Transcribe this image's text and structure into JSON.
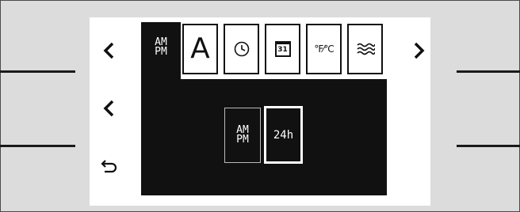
{
  "tabs": {
    "active_label": "AM\nPM",
    "font_label": "A",
    "date_label": "31",
    "temp_label": "°F⁄°C"
  },
  "options": {
    "ampm_label": "AM\nPM",
    "h24_label": "24h",
    "selected": "24h"
  },
  "icons": {
    "left_top": "chevron-left-icon",
    "left_mid": "chevron-left-icon",
    "back": "back-arrow-icon",
    "right_top": "chevron-right-icon"
  }
}
